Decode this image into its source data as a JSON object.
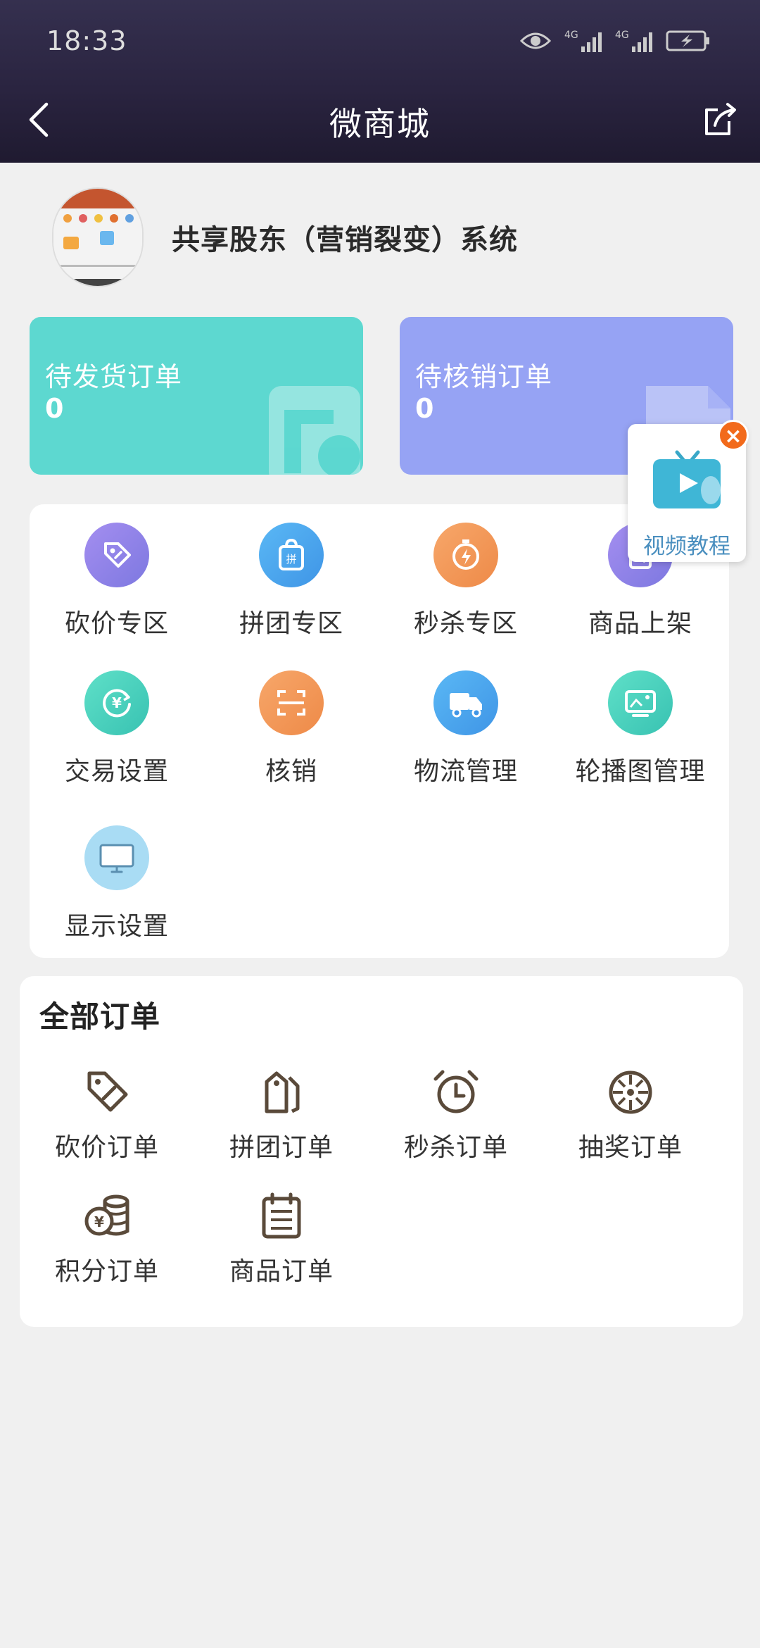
{
  "status_bar": {
    "time": "18:33"
  },
  "header": {
    "title": "微商城"
  },
  "shop": {
    "name": "共享股东（营销裂变）系统"
  },
  "order_cards": [
    {
      "label": "待发货订单",
      "count": "0",
      "color": "#5dd8d0"
    },
    {
      "label": "待核销订单",
      "count": "0",
      "color": "#96a3f4"
    }
  ],
  "video_tip": {
    "label": "视频教程",
    "close": "×"
  },
  "functions": [
    {
      "label": "砍价专区",
      "icon": "tag-icon",
      "color": "#8f84e6"
    },
    {
      "label": "拼团专区",
      "icon": "group-bag-icon",
      "color": "#4ea9ef"
    },
    {
      "label": "秒杀专区",
      "icon": "lightning-icon",
      "color": "#f29a5c"
    },
    {
      "label": "商品上架",
      "icon": "product-icon",
      "color": "#8f84e6"
    },
    {
      "label": "交易设置",
      "icon": "yen-cycle-icon",
      "color": "#4fd3c0"
    },
    {
      "label": "核销",
      "icon": "scan-icon",
      "color": "#f29a5c"
    },
    {
      "label": "物流管理",
      "icon": "truck-icon",
      "color": "#4ea9ef"
    },
    {
      "label": "轮播图管理",
      "icon": "carousel-icon",
      "color": "#4fd3c0"
    },
    {
      "label": "显示设置",
      "icon": "monitor-icon",
      "color": "#a9dcf4"
    }
  ],
  "all_orders": {
    "title": "全部订单",
    "items": [
      {
        "label": "砍价订单",
        "icon": "tag-outline-icon"
      },
      {
        "label": "拼团订单",
        "icon": "tags-outline-icon"
      },
      {
        "label": "秒杀订单",
        "icon": "alarm-clock-icon"
      },
      {
        "label": "抽奖订单",
        "icon": "wheel-icon"
      },
      {
        "label": "积分订单",
        "icon": "coins-icon"
      },
      {
        "label": "商品订单",
        "icon": "list-icon"
      }
    ]
  }
}
